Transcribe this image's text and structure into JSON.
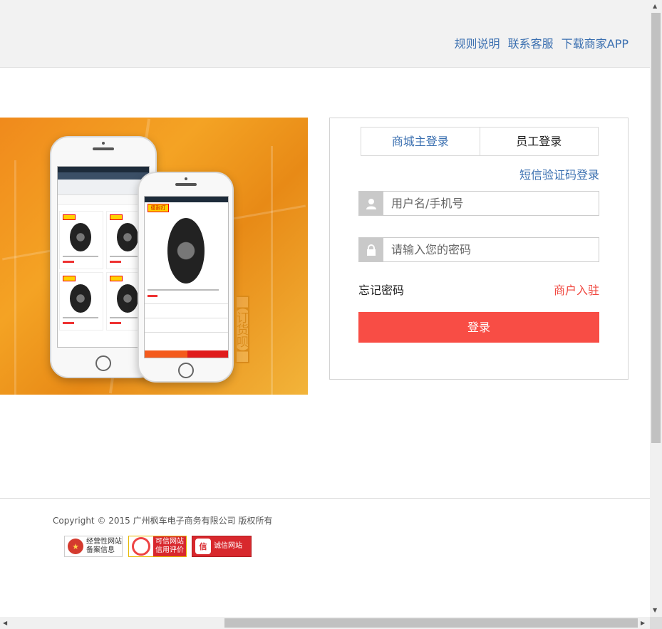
{
  "header": {
    "links": [
      "规则说明",
      "联系客服",
      "下载商家APP"
    ]
  },
  "banner": {
    "side_tab": "【订货呗】",
    "tag_text": "德耐打"
  },
  "login": {
    "tabs": [
      "商城主登录",
      "员工登录"
    ],
    "sms_login": "短信验证码登录",
    "username_placeholder": "用户名/手机号",
    "password_placeholder": "请输入您的密码",
    "forgot_password": "忘记密码",
    "merchant_join": "商户入驻",
    "submit": "登录"
  },
  "footer": {
    "copyright": "Copyright © 2015 广州枫车电子商务有限公司 版权所有",
    "badges": [
      {
        "line1": "经营性网站",
        "line2": "备案信息"
      },
      {
        "line1": "可信网站",
        "line2": "信用评价"
      },
      {
        "line1": "诚信网站",
        "icon_text": "信"
      }
    ]
  },
  "colors": {
    "link_blue": "#3a6fb0",
    "accent_red": "#f84d45",
    "merchant_red": "#f0473f"
  }
}
